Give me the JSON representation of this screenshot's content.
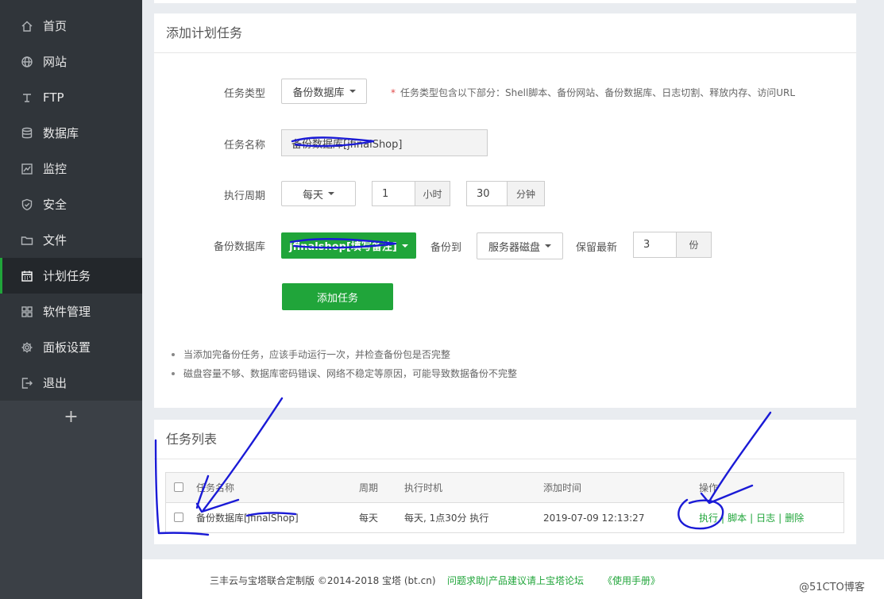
{
  "sidebar": {
    "items": [
      {
        "label": "首页",
        "icon": "home-icon"
      },
      {
        "label": "网站",
        "icon": "globe-icon"
      },
      {
        "label": "FTP",
        "icon": "ftp-icon"
      },
      {
        "label": "数据库",
        "icon": "database-icon"
      },
      {
        "label": "监控",
        "icon": "monitor-icon"
      },
      {
        "label": "安全",
        "icon": "shield-icon"
      },
      {
        "label": "文件",
        "icon": "folder-icon"
      },
      {
        "label": "计划任务",
        "icon": "calendar-icon",
        "active": true
      },
      {
        "label": "软件管理",
        "icon": "apps-icon"
      },
      {
        "label": "面板设置",
        "icon": "gear-icon"
      },
      {
        "label": "退出",
        "icon": "logout-icon"
      }
    ],
    "add_label": "+"
  },
  "add_task": {
    "title": "添加计划任务",
    "task_type_label": "任务类型",
    "task_type_value": "备份数据库",
    "task_type_hint": "任务类型包含以下部分：Shell脚本、备份网站、备份数据库、日志切割、释放内存、访问URL",
    "task_name_label": "任务名称",
    "task_name_value": "备份数据库[jfinalShop]",
    "period_label": "执行周期",
    "period_value": "每天",
    "hour_value": "1",
    "hour_unit": "小时",
    "minute_value": "30",
    "minute_unit": "分钟",
    "backup_db_label": "备份数据库",
    "backup_db_value": "jfinalshop[填写备注]",
    "backup_to_label": "备份到",
    "backup_to_value": "服务器磁盘",
    "keep_label": "保留最新",
    "keep_value": "3",
    "keep_unit": "份",
    "submit_label": "添加任务",
    "notes": [
      "当添加完备份任务，应该手动运行一次，并检查备份包是否完整",
      "磁盘容量不够、数据库密码错误、网络不稳定等原因，可能导致数据备份不完整"
    ]
  },
  "task_list": {
    "title": "任务列表",
    "columns": [
      "任务名称",
      "周期",
      "执行时机",
      "添加时间",
      "操作"
    ],
    "rows": [
      {
        "name": "备份数据库[jfinalShop]",
        "period": "每天",
        "timing": "每天, 1点30分 执行",
        "added": "2019-07-09 12:13:27",
        "actions": [
          "执行",
          "脚本",
          "日志",
          "删除"
        ]
      }
    ]
  },
  "footer": {
    "copyright": "三丰云与宝塔联合定制版 ©2014-2018 宝塔 (bt.cn)",
    "help": "问题求助|产品建议请上宝塔论坛",
    "manual": "《使用手册》",
    "watermark": "@51CTO博客"
  },
  "colors": {
    "accent": "#20a53a",
    "sidebar_bg": "#30353a",
    "annotation_ink": "#1a1ad6",
    "required_star": "#e14a4a"
  }
}
